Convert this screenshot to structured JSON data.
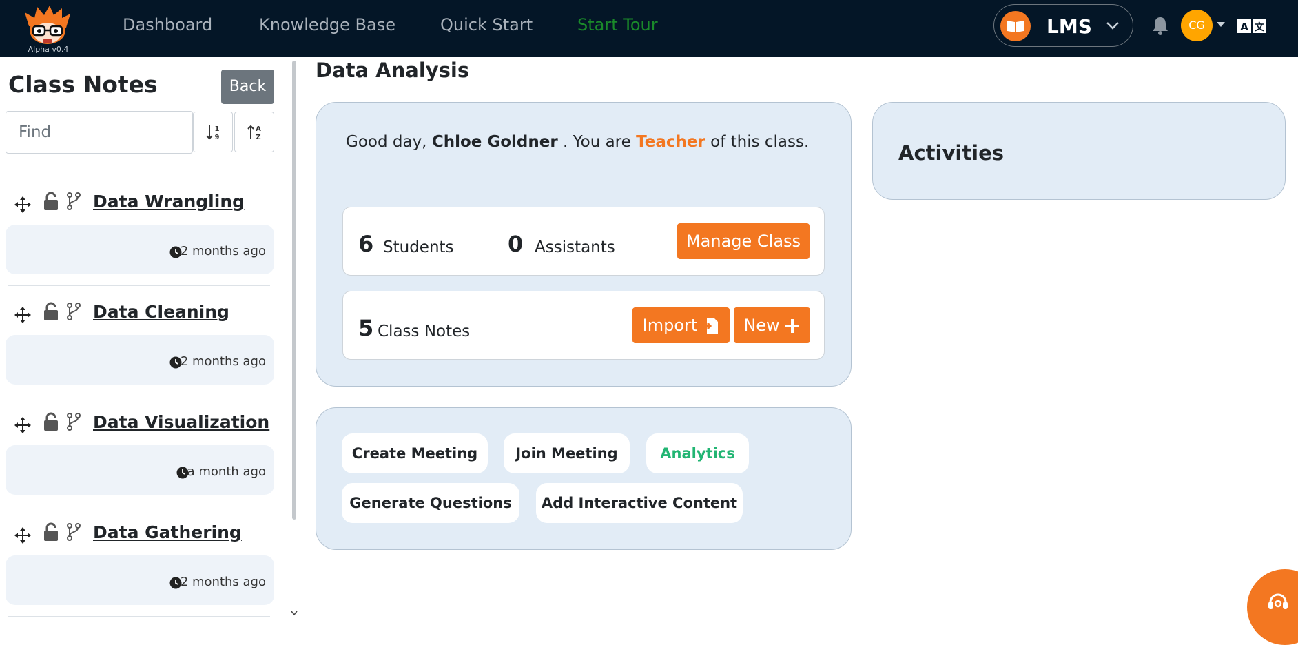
{
  "app": {
    "logo_version": "Alpha v0.4"
  },
  "nav": {
    "links": [
      "Dashboard",
      "Knowledge Base",
      "Quick Start",
      "Start Tour"
    ],
    "lms_label": "LMS",
    "avatar_initials": "CG"
  },
  "sidebar": {
    "title": "Class Notes",
    "back_label": "Back",
    "find_placeholder": "Find",
    "notes": [
      {
        "title": "Data Wrangling",
        "time": "2 months ago"
      },
      {
        "title": "Data Cleaning",
        "time": "2 months ago"
      },
      {
        "title": "Data Visualization",
        "time": "a month ago"
      },
      {
        "title": "Data Gathering",
        "time": "2 months ago"
      }
    ]
  },
  "main": {
    "page_title": "Data Analysis",
    "greeting": {
      "prefix": "Good day,",
      "name": "Chloe Goldner",
      "middle": ". You are",
      "role": "Teacher",
      "suffix": "of this class."
    },
    "stats": {
      "students_count": "6",
      "students_label": "Students",
      "assistants_count": "0",
      "assistants_label": "Assistants",
      "manage_label": "Manage Class",
      "notes_count": "5",
      "notes_label": "Class Notes",
      "import_label": "Import",
      "new_label": "New"
    },
    "actions": [
      "Create Meeting",
      "Join Meeting",
      "Analytics",
      "Generate Questions",
      "Add Interactive Content"
    ]
  },
  "activities": {
    "title": "Activities"
  },
  "colors": {
    "navbar": "#041627",
    "accent": "#f37721",
    "card": "#e2ecf6",
    "analytics": "#22b573",
    "tour": "#1a8a2a"
  },
  "icons": [
    "app-logo",
    "book-icon",
    "chevron-down-icon",
    "bell-icon",
    "translate-icon",
    "sort-numeric-down-icon",
    "sort-alpha-up-icon",
    "move-icon",
    "unlock-icon",
    "branch-icon",
    "clock-icon",
    "import-file-icon",
    "plus-icon",
    "headset-icon"
  ]
}
